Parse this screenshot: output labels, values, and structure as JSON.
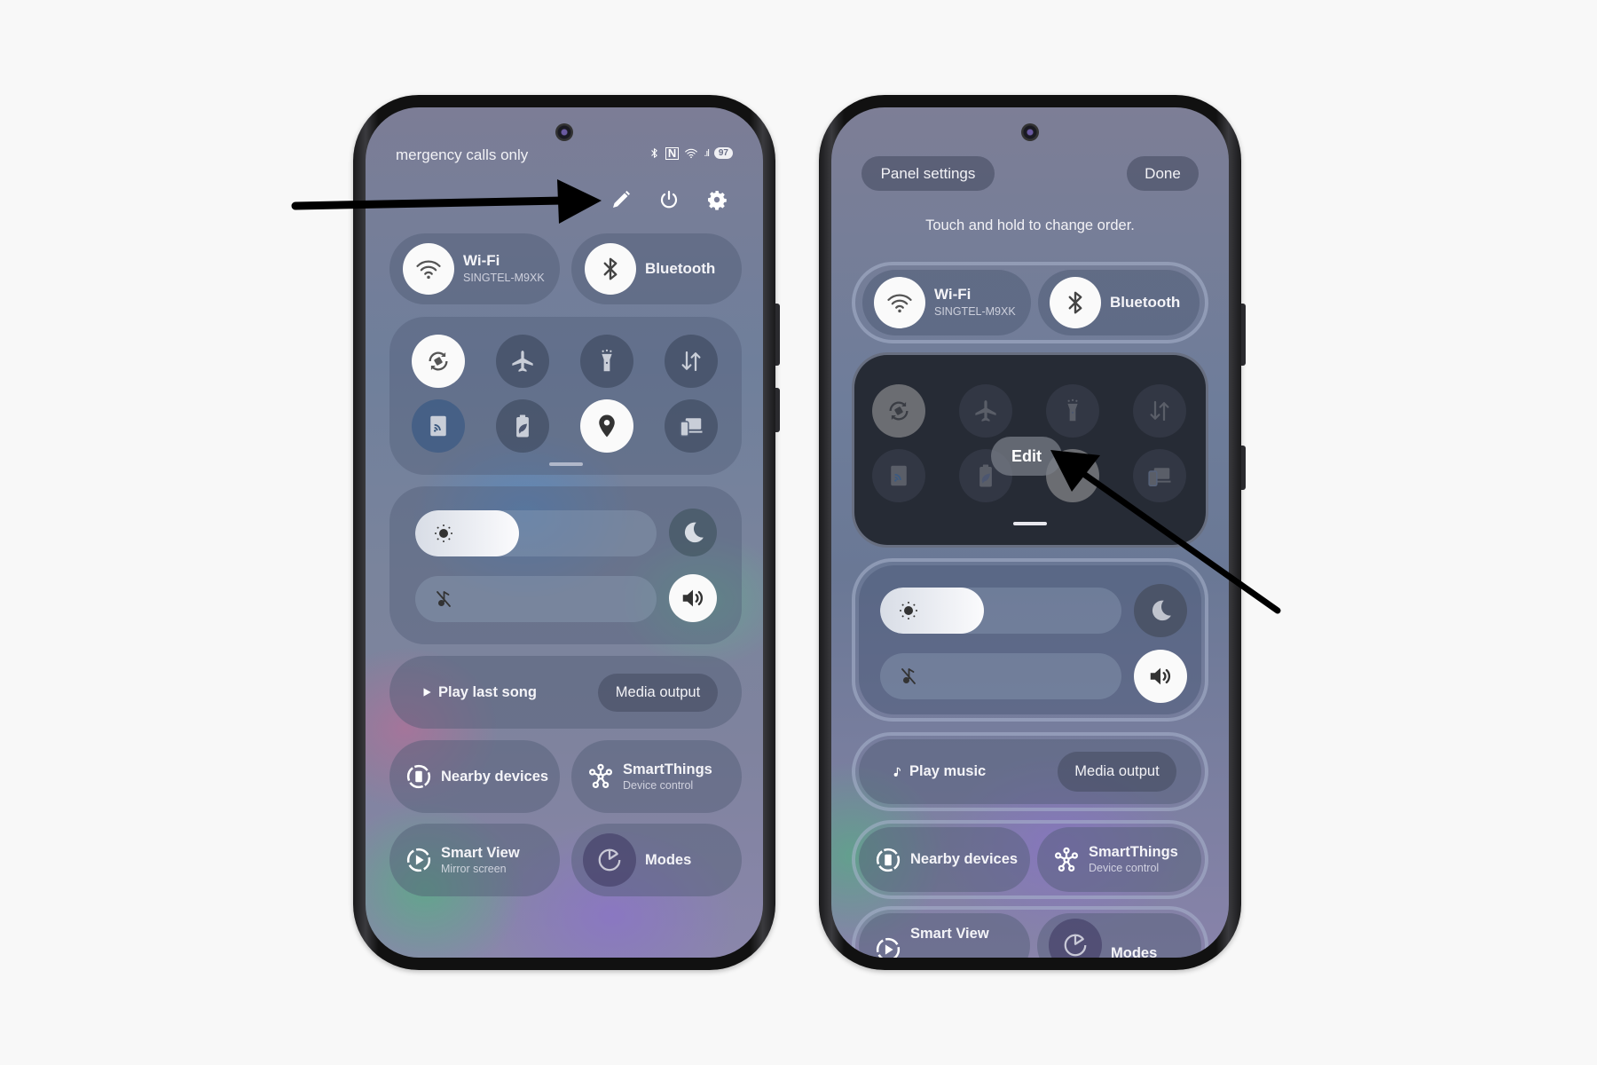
{
  "left_phone": {
    "status_bar": {
      "carrier_text": "mergency calls only",
      "icons": [
        "bluetooth-icon",
        "nfc-icon",
        "wifi-icon",
        "signal-icon"
      ],
      "battery": "97"
    },
    "header_icons": [
      "edit-pencil-icon",
      "power-icon",
      "settings-gear-icon"
    ],
    "big_tiles": [
      {
        "label": "Wi-Fi",
        "sub": "SINGTEL-M9XK",
        "icon": "wifi-icon",
        "active": true
      },
      {
        "label": "Bluetooth",
        "sub": "",
        "icon": "bluetooth-icon",
        "active": true
      }
    ],
    "quick_toggles": [
      {
        "name": "auto-rotate",
        "icon": "auto-rotate-icon",
        "active": true
      },
      {
        "name": "airplane-mode",
        "icon": "airplane-icon",
        "active": false
      },
      {
        "name": "flashlight",
        "icon": "flashlight-icon",
        "active": false
      },
      {
        "name": "mobile-data",
        "icon": "data-arrows-icon",
        "active": false
      },
      {
        "name": "nfc",
        "icon": "nfc-card-icon",
        "active": false
      },
      {
        "name": "power-saving",
        "icon": "battery-leaf-icon",
        "active": false
      },
      {
        "name": "location",
        "icon": "location-pin-icon",
        "active": true
      },
      {
        "name": "device-link",
        "icon": "devices-icon",
        "active": false
      }
    ],
    "brightness": {
      "icon": "sun-icon",
      "level_percent": 43
    },
    "dark_mode_icon": "moon-icon",
    "volume": {
      "icon": "music-mute-icon",
      "level_percent": 0
    },
    "sound_icon": "speaker-icon",
    "media": {
      "play_label": "Play last song",
      "output_label": "Media output"
    },
    "tiles": [
      {
        "label": "Nearby devices",
        "sub": "",
        "icon": "nearby-devices-icon"
      },
      {
        "label": "SmartThings",
        "sub": "Device control",
        "icon": "smartthings-icon"
      },
      {
        "label": "Smart View",
        "sub": "Mirror screen",
        "icon": "smart-view-icon"
      },
      {
        "label": "Modes",
        "sub": "",
        "icon": "modes-icon"
      }
    ]
  },
  "right_phone": {
    "panel_settings_label": "Panel settings",
    "done_label": "Done",
    "hint": "Touch and hold to change order.",
    "big_tiles": [
      {
        "label": "Wi-Fi",
        "sub": "SINGTEL-M9XK"
      },
      {
        "label": "Bluetooth",
        "sub": ""
      }
    ],
    "edit_label": "Edit",
    "brightness": {
      "level_percent": 43
    },
    "volume": {
      "level_percent": 0
    },
    "media": {
      "play_label": "Play music",
      "output_label": "Media output"
    },
    "tiles": [
      {
        "label": "Nearby devices",
        "sub": ""
      },
      {
        "label": "SmartThings",
        "sub": "Device control"
      },
      {
        "label": "Smart View",
        "sub": ""
      },
      {
        "label": "Modes",
        "sub": ""
      }
    ]
  },
  "annotations": [
    "arrow-to-edit-pencil",
    "arrow-to-edit-pill"
  ],
  "colors": {
    "active_tile": "#fafafa",
    "inactive_tile": "#4a5670",
    "dark_panel": "#262b35",
    "arrow": "#000000"
  }
}
